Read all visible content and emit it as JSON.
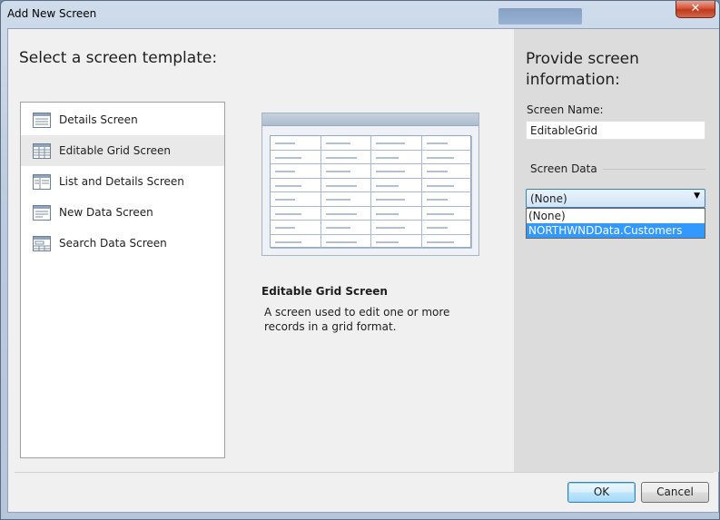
{
  "window": {
    "title": "Add New Screen",
    "close_glyph": "✕"
  },
  "left": {
    "heading": "Select a screen template:",
    "templates": [
      {
        "label": "Details Screen",
        "icon": "details-screen-icon"
      },
      {
        "label": "Editable Grid Screen",
        "icon": "grid-screen-icon",
        "selected": true
      },
      {
        "label": "List and Details Screen",
        "icon": "list-details-screen-icon"
      },
      {
        "label": "New Data Screen",
        "icon": "new-data-screen-icon"
      },
      {
        "label": "Search Data Screen",
        "icon": "search-data-screen-icon"
      }
    ],
    "description_title": "Editable Grid Screen",
    "description_text": "A screen used to edit one or more records in a grid format."
  },
  "right": {
    "heading": "Provide screen information:",
    "screen_name_label": "Screen Name:",
    "screen_name_value": "EditableGrid",
    "screen_data_label": "Screen Data",
    "screen_data_selected": "(None)",
    "screen_data_options": [
      "(None)",
      "NORTHWNDData.Customers"
    ],
    "screen_data_highlighted_index": 1
  },
  "footer": {
    "ok_label": "OK",
    "cancel_label": "Cancel"
  },
  "colors": {
    "selection_highlight": "#3399ff",
    "right_pane_bg": "#dcdcdc",
    "close_button": "#c0391c"
  }
}
